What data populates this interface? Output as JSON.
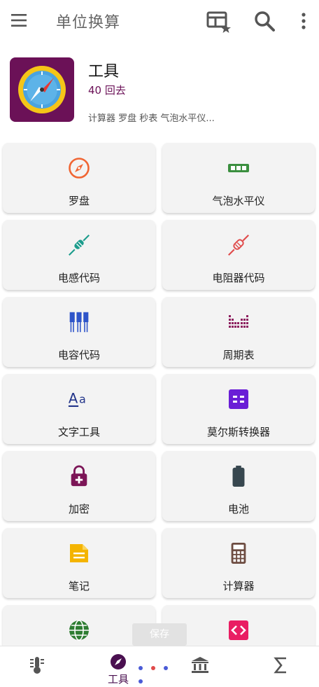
{
  "appbar": {
    "title": "单位换算",
    "icons": [
      "menu-icon",
      "favorites-grid-icon",
      "search-icon",
      "more-vert-icon"
    ]
  },
  "header": {
    "title": "工具",
    "subtitle": "40 回去",
    "description": "计算器 罗盘 秒表 气泡水平仪...",
    "logo": "compass-logo"
  },
  "tools": [
    {
      "label": "罗盘",
      "icon": "compass-icon",
      "color": "#f06533"
    },
    {
      "label": "气泡水平仪",
      "icon": "bubble-level-icon",
      "color": "#3b8f3f"
    },
    {
      "label": "电感代码",
      "icon": "inductor-icon",
      "color": "#1c9c8c"
    },
    {
      "label": "电阻器代码",
      "icon": "resistor-icon",
      "color": "#e04a4a"
    },
    {
      "label": "电容代码",
      "icon": "capacitor-icon",
      "color": "#2f55c9"
    },
    {
      "label": "周期表",
      "icon": "periodic-table-icon",
      "color": "#8c1e5e"
    },
    {
      "label": "文字工具",
      "icon": "text-tools-icon",
      "color": "#23358a"
    },
    {
      "label": "莫尔斯转换器",
      "icon": "morse-icon",
      "color": "#6a1ed6"
    },
    {
      "label": "加密",
      "icon": "lock-icon",
      "color": "#7c1557"
    },
    {
      "label": "电池",
      "icon": "battery-icon",
      "color": "#37474f"
    },
    {
      "label": "笔记",
      "icon": "note-icon",
      "color": "#f4b400"
    },
    {
      "label": "计算器",
      "icon": "calculator-icon",
      "color": "#6d4c41"
    },
    {
      "label": "",
      "icon": "globe-icon",
      "color": "#2e7d32"
    },
    {
      "label": "",
      "icon": "code-icon",
      "color": "#e91e63"
    }
  ],
  "toast": {
    "text": "保存"
  },
  "bottom_nav": {
    "items": [
      {
        "label": "",
        "icon": "thermometer-icon"
      },
      {
        "label": "工具",
        "icon": "compass-nav-icon",
        "active": true
      },
      {
        "label": "",
        "icon": "bank-icon"
      },
      {
        "label": "",
        "icon": "sigma-icon"
      }
    ],
    "dot_colors": [
      "#4a5bd6",
      "#e04a4a",
      "#4a5bd6",
      "#4a5bd6"
    ]
  }
}
